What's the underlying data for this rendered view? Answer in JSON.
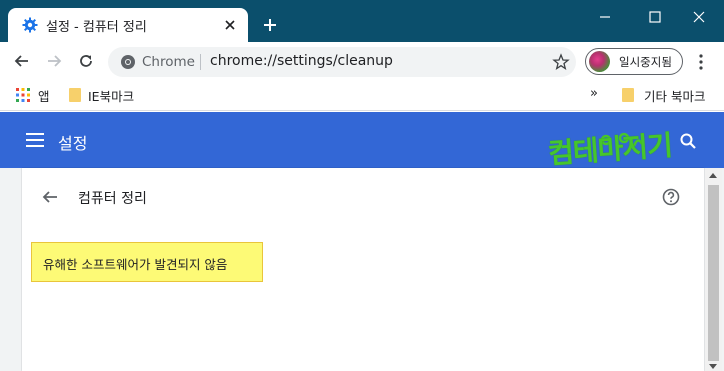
{
  "window": {
    "tab_title": "설정 - 컴퓨터 정리"
  },
  "toolbar": {
    "origin_label": "Chrome",
    "url": "chrome://settings/cleanup",
    "profile_label": "일시중지됨"
  },
  "bookmarks": {
    "apps_label": "앱",
    "items": [
      {
        "label": "IE북마크"
      }
    ],
    "other_label": "기타 북마크",
    "more_label": "»"
  },
  "settings": {
    "header_title": "설정",
    "page_title": "컴퓨터 정리",
    "notice": "유해한 소프트웨어가 발견되지 않음"
  },
  "watermark": {
    "text": "컴테마지기"
  },
  "colors": {
    "titlebar": "#0b4f6c",
    "header": "#3367d6",
    "highlight": "#fdfa76",
    "watermark": "#46c62b"
  }
}
